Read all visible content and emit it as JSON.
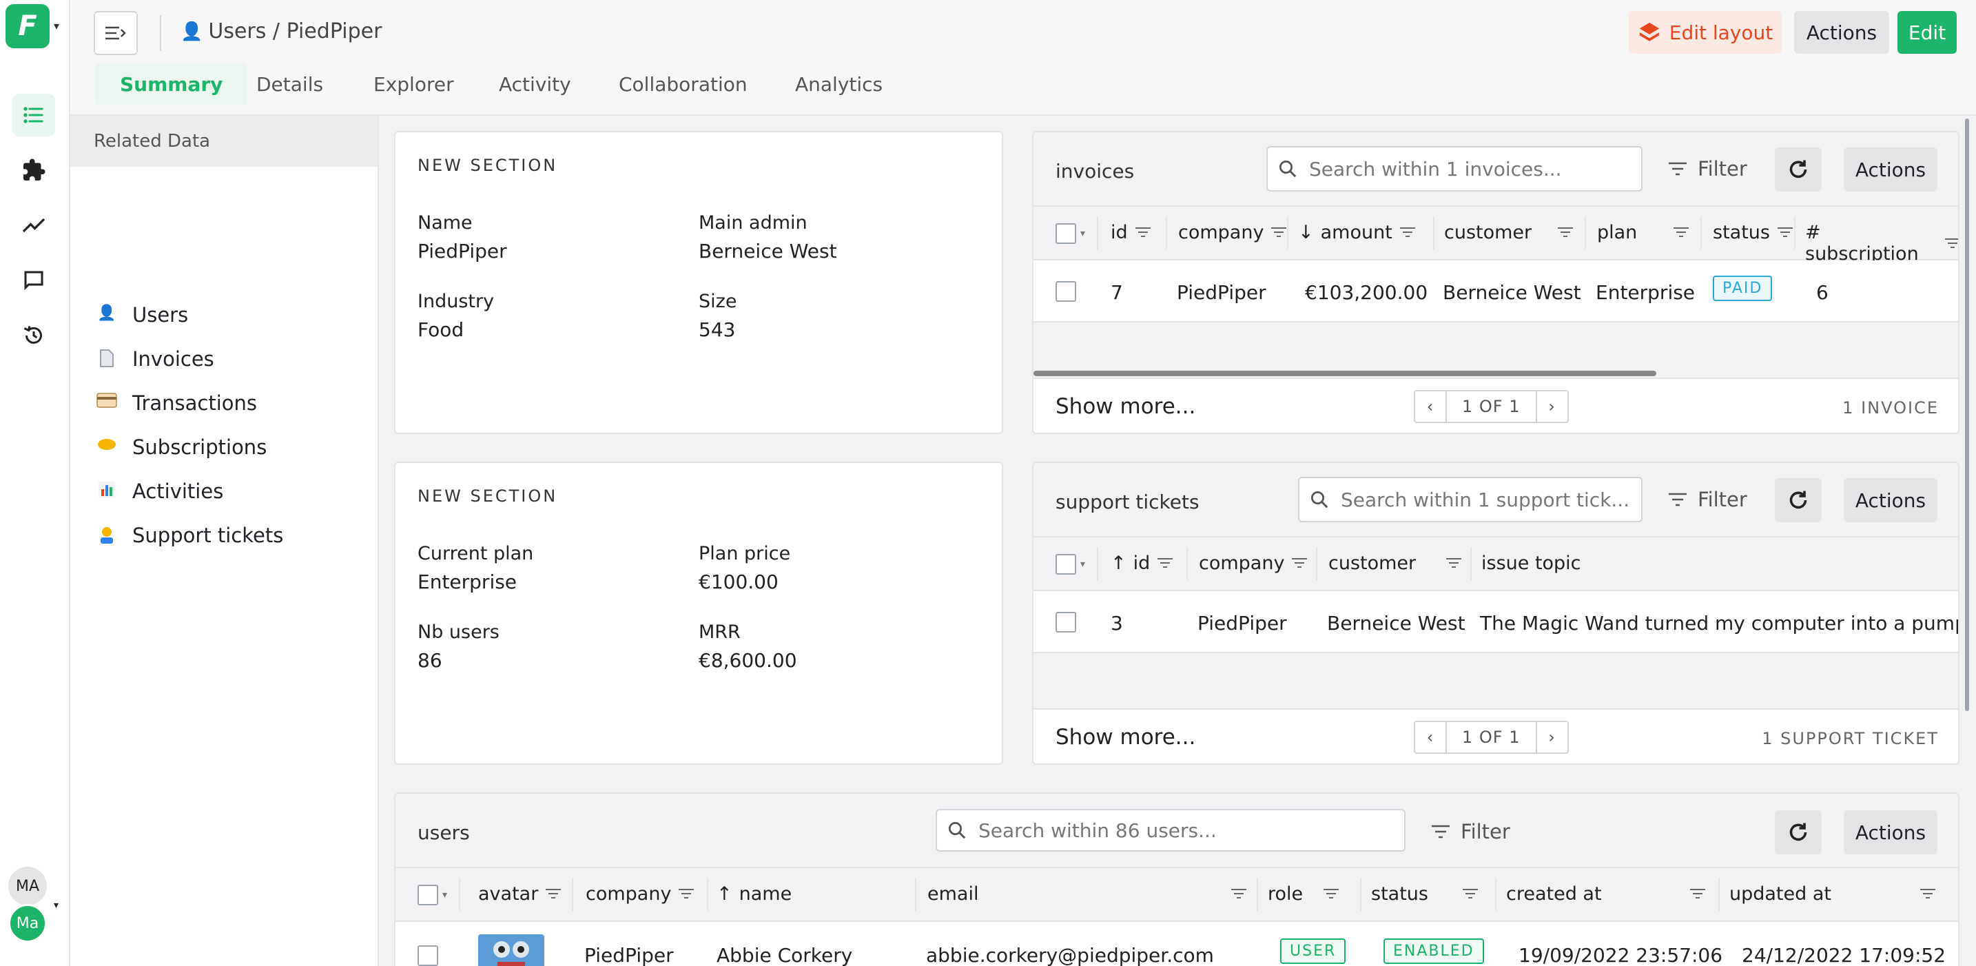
{
  "app": {
    "logo_letter": "F"
  },
  "user": {
    "initials_top": "MA",
    "initials_bottom": "Ma"
  },
  "breadcrumb": {
    "text": "Users / PiedPiper"
  },
  "header": {
    "edit_layout": "Edit layout",
    "actions": "Actions",
    "edit": "Edit"
  },
  "tabs": [
    "Summary",
    "Details",
    "Explorer",
    "Activity",
    "Collaboration",
    "Analytics"
  ],
  "related": {
    "title": "Related Data",
    "items": [
      {
        "label": "Users",
        "icon": "user-icon"
      },
      {
        "label": "Invoices",
        "icon": "document-icon"
      },
      {
        "label": "Transactions",
        "icon": "credit-card-icon"
      },
      {
        "label": "Subscriptions",
        "icon": "handshake-icon"
      },
      {
        "label": "Activities",
        "icon": "bar-chart-icon"
      },
      {
        "label": "Support tickets",
        "icon": "support-agent-icon"
      }
    ]
  },
  "section1": {
    "title": "NEW SECTION",
    "name_label": "Name",
    "name_value": "PiedPiper",
    "admin_label": "Main admin",
    "admin_value": "Berneice West",
    "industry_label": "Industry",
    "industry_value": "Food",
    "size_label": "Size",
    "size_value": "543"
  },
  "section2": {
    "title": "NEW SECTION",
    "plan_label": "Current plan",
    "plan_value": "Enterprise",
    "price_label": "Plan price",
    "price_value": "€100.00",
    "nb_label": "Nb users",
    "nb_value": "86",
    "mrr_label": "MRR",
    "mrr_value": "€8,600.00"
  },
  "invoices": {
    "title": "invoices",
    "search_placeholder": "Search within 1 invoices...",
    "filter": "Filter",
    "actions": "Actions",
    "columns": [
      "id",
      "company",
      "amount",
      "customer",
      "plan",
      "status",
      "# subscription"
    ],
    "row": {
      "id": "7",
      "company": "PiedPiper",
      "amount": "€103,200.00",
      "customer": "Berneice West",
      "plan": "Enterprise",
      "status": "PAID",
      "subscription": "6"
    },
    "show_more": "Show more...",
    "pager": "1 OF 1",
    "count": "1 INVOICE"
  },
  "tickets": {
    "title": "support tickets",
    "search_placeholder": "Search within 1 support tick...",
    "filter": "Filter",
    "actions": "Actions",
    "columns": [
      "id",
      "company",
      "customer",
      "issue topic"
    ],
    "row": {
      "id": "3",
      "company": "PiedPiper",
      "customer": "Berneice West",
      "topic": "The Magic Wand turned my computer into a pumpkin"
    },
    "show_more": "Show more...",
    "pager": "1 OF 1",
    "count": "1 SUPPORT TICKET"
  },
  "users_table": {
    "title": "users",
    "search_placeholder": "Search within 86 users...",
    "filter": "Filter",
    "actions": "Actions",
    "columns": [
      "avatar",
      "company",
      "name",
      "email",
      "role",
      "status",
      "created at",
      "updated at"
    ],
    "row": {
      "company": "PiedPiper",
      "name": "Abbie Corkery",
      "email": "abbie.corkery@piedpiper.com",
      "role": "USER",
      "status": "ENABLED",
      "created": "19/09/2022 23:57:06",
      "updated": "24/12/2022 17:09:52"
    }
  },
  "colors": {
    "accent": "#1db36a",
    "link": "#2f80ed",
    "edit_layout": "#e8461c"
  }
}
